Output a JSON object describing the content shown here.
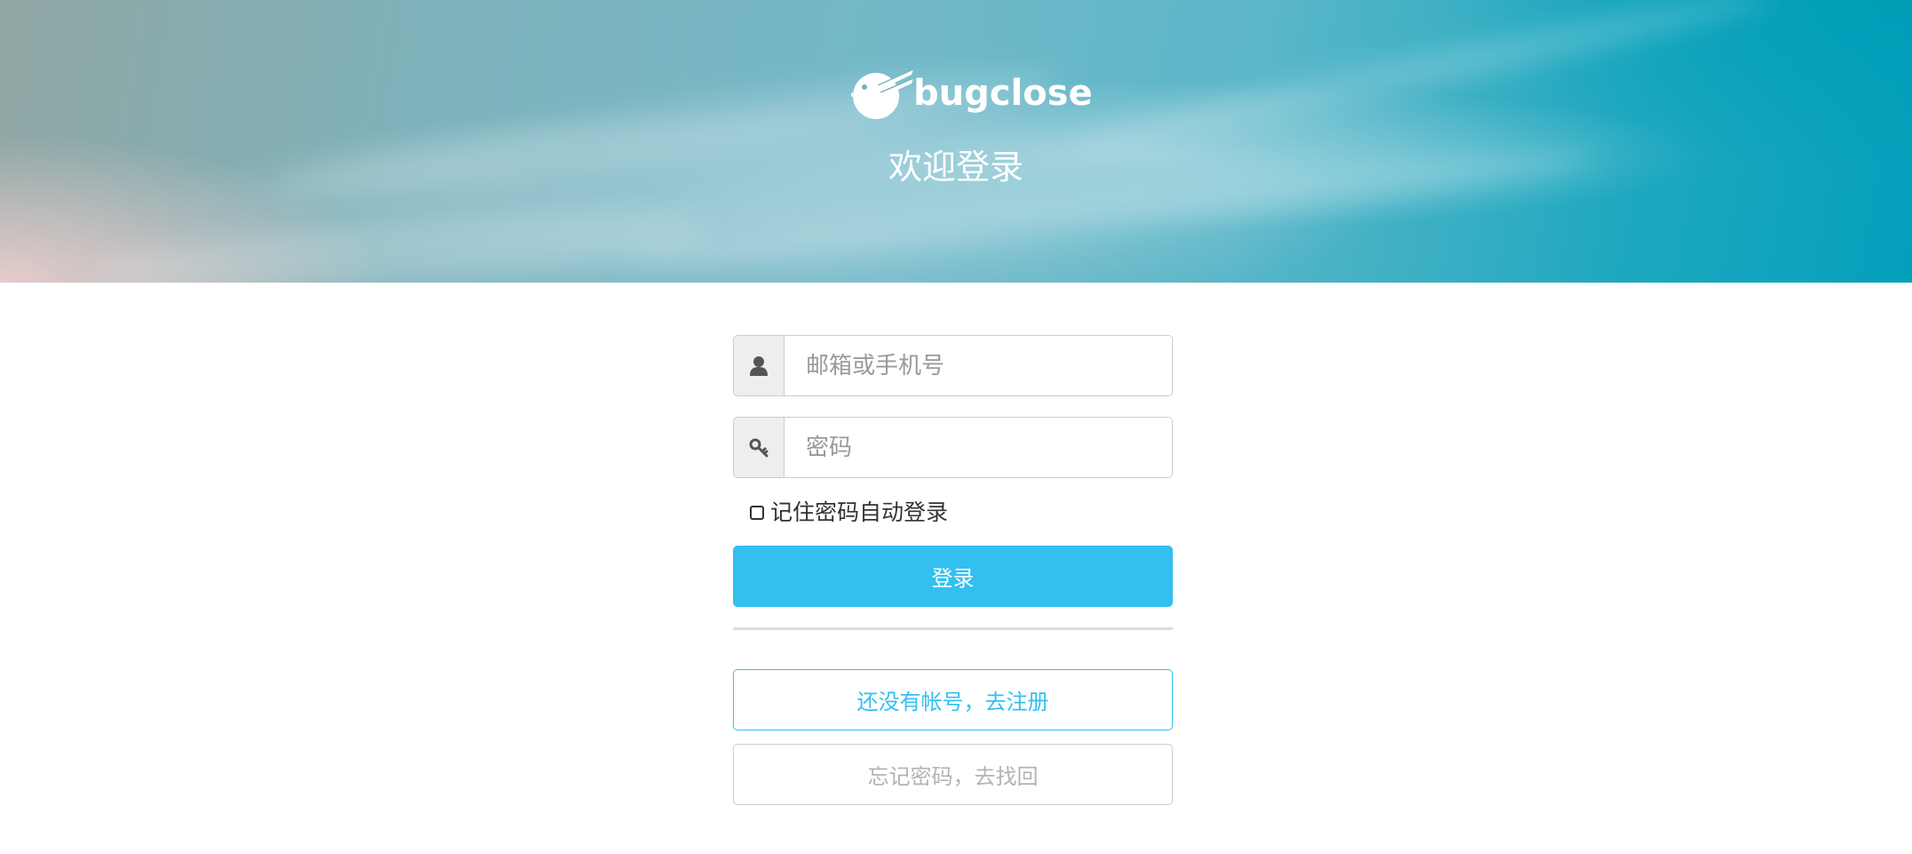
{
  "header": {
    "brand_name": "bugclose",
    "welcome_title": "欢迎登录"
  },
  "login_form": {
    "account_placeholder": "邮箱或手机号",
    "account_icon": "user-icon",
    "password_placeholder": "密码",
    "password_icon": "key-icon",
    "remember_label": "记住密码自动登录",
    "remember_checked": false,
    "login_button": "登录",
    "register_link": "还没有帐号，去注册",
    "forgot_link": "忘记密码，去找回"
  },
  "colors": {
    "accent": "#33bff0",
    "muted_text": "#b3b3b3"
  }
}
